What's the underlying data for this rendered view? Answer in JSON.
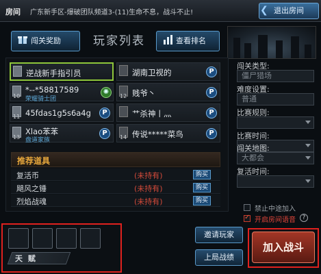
{
  "topbar": {
    "room_label": "房间",
    "room_info": "广东新手区-爆破团队频道3-(11)生命不息，战斗不止!",
    "exit_label": "退出房间"
  },
  "header": {
    "reward_label": "闯关奖励",
    "title": "玩家列表",
    "rank_label": "查看排名"
  },
  "players": [
    {
      "name": "逆战新手指引员",
      "level": "",
      "clan": "",
      "badge": "",
      "selected": true
    },
    {
      "name": "湖南卫视的",
      "level": "",
      "clan": "",
      "badge": "P",
      "selected": false
    },
    {
      "name": "*--*58817589",
      "level": "10",
      "clan": "荣耀骑士团",
      "badge": "G",
      "selected": false
    },
    {
      "name": "贱爷丶",
      "level": "12",
      "clan": "",
      "badge": "P",
      "selected": false
    },
    {
      "name": "45fdas1g5s6a4g",
      "level": "11",
      "clan": "",
      "badge": "P",
      "selected": false
    },
    {
      "name": "艹杀神丨灬",
      "level": "",
      "clan": "",
      "badge": "P",
      "selected": false
    },
    {
      "name": "Xlao苯苯",
      "level": "13",
      "clan": "盘道家族",
      "badge": "P",
      "selected": false
    },
    {
      "name": "传说*****菜鸟",
      "level": "14",
      "clan": "",
      "badge": "P",
      "selected": false
    }
  ],
  "recommend": {
    "title": "推荐道具",
    "items": [
      {
        "name": "复活币",
        "status": "(未持有)",
        "buy": "购买"
      },
      {
        "name": "飓风之锤",
        "status": "(未持有)",
        "buy": "购买"
      },
      {
        "name": "烈焰战魂",
        "status": "(未持有)",
        "buy": "购买"
      }
    ]
  },
  "settings": {
    "mode_label": "闯关类型:",
    "mode_value": "僵尸猎场",
    "difficulty_label": "难度设置:",
    "difficulty_value": "普通",
    "rules_label": "比赛规则:",
    "rules_value": "",
    "time_label": "比赛时间:",
    "time_value": "",
    "map_label": "闯关地图:",
    "map_value": "大都会",
    "revive_label": "复活时间:",
    "revive_value": "",
    "no_join_label": "禁止中途加入",
    "voice_label": "开启房间语音",
    "help": "?"
  },
  "bottom": {
    "talent_label": "天 赋",
    "invite_label": "邀请玩家",
    "history_label": "上局战绩",
    "join_label": "加入战斗"
  },
  "colors": {
    "accent_blue": "#5a9bcc",
    "highlight_red": "#e0211e",
    "selected_green": "#8ec63a",
    "not_owned": "#d24a3a"
  }
}
